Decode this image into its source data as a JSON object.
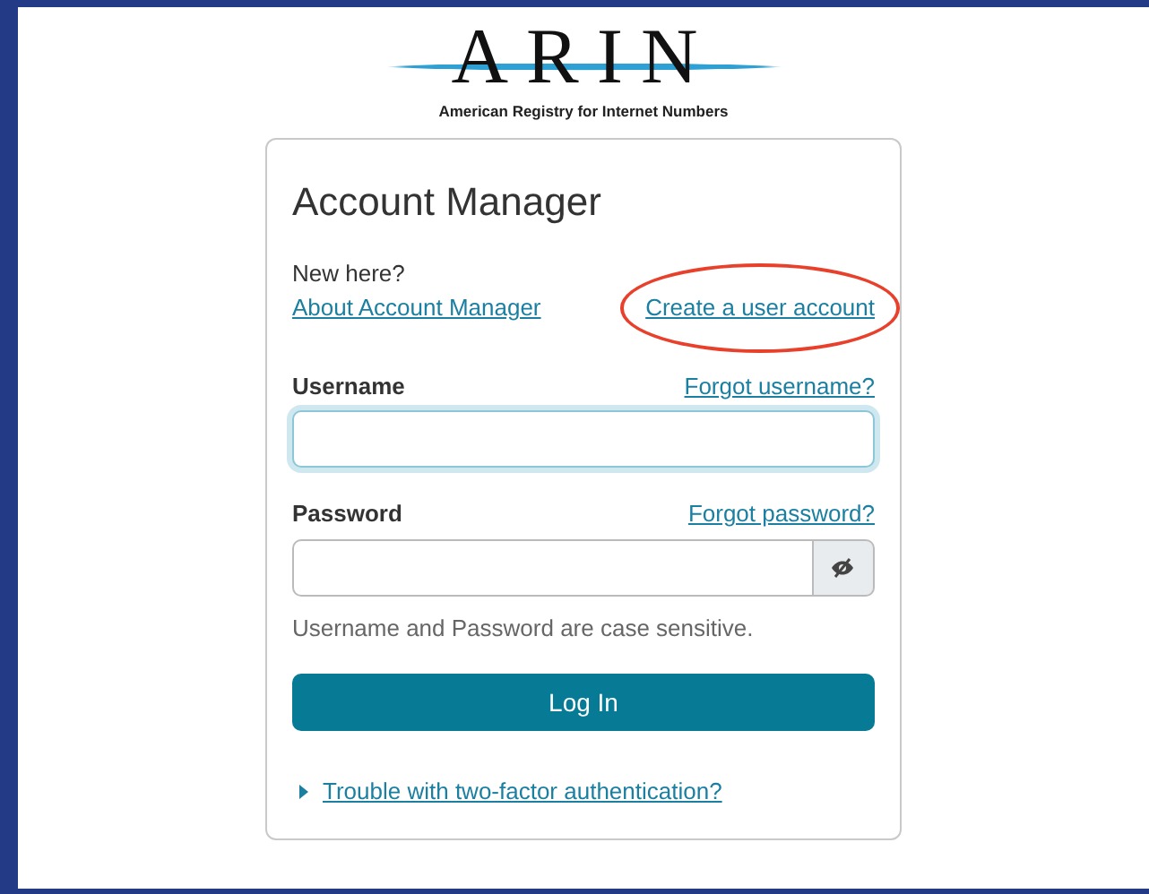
{
  "logo": {
    "name": "ARIN",
    "subtitle": "American Registry for Internet Numbers"
  },
  "card": {
    "title": "Account Manager",
    "intro": "New here?",
    "links": [
      {
        "label": "About Account Manager",
        "circled": false
      },
      {
        "label": "Create a user account",
        "circled": true
      }
    ],
    "fields": [
      {
        "label": "Username",
        "link": "Forgot username?",
        "focused": true,
        "kind": "text"
      },
      {
        "label": "Password",
        "link": "Forgot password?",
        "focused": false,
        "kind": "password"
      }
    ],
    "hint": "Username and Password are case sensitive.",
    "submit": "Log In",
    "disclosure": {
      "label": "Trouble with two-factor authentication?",
      "expanded": false
    }
  }
}
